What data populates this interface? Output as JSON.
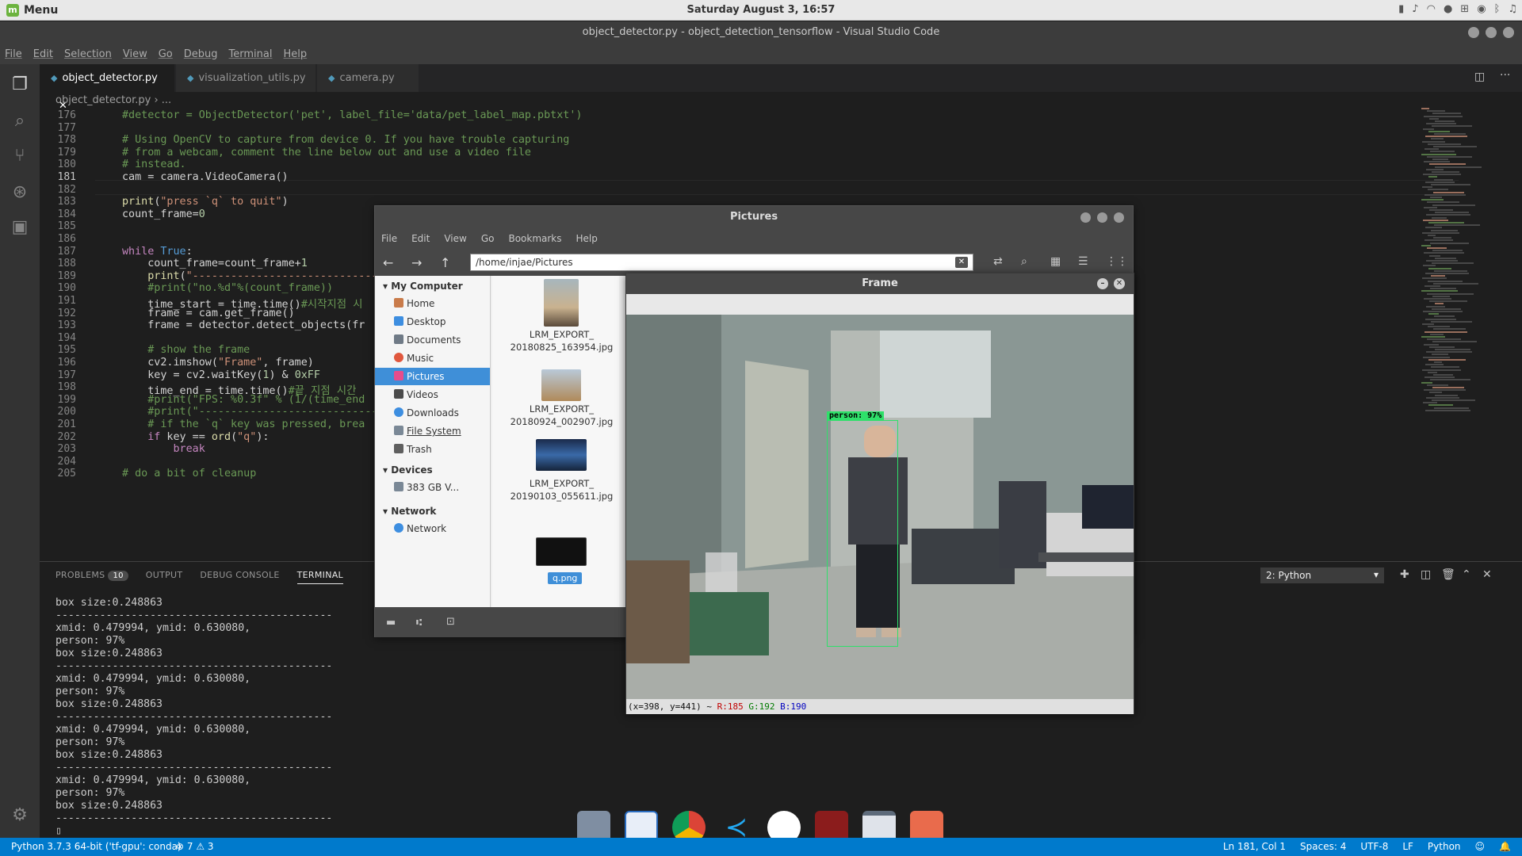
{
  "top_panel": {
    "menu_label": "Menu",
    "clock": "Saturday August  3, 16:57"
  },
  "window_title": "object_detector.py - object_detection_tensorflow - Visual Studio Code",
  "menubar": [
    "File",
    "Edit",
    "Selection",
    "View",
    "Go",
    "Debug",
    "Terminal",
    "Help"
  ],
  "tabs": [
    {
      "label": "object_detector.py",
      "active": true
    },
    {
      "label": "visualization_utils.py",
      "active": false
    },
    {
      "label": "camera.py",
      "active": false
    }
  ],
  "breadcrumb": "object_detector.py › ...",
  "editor": {
    "current_line": 181,
    "lines": [
      {
        "n": 176,
        "html": "<span class='c-com'>#detector = ObjectDetector('pet', label_file='data/pet_label_map.pbtxt')</span>"
      },
      {
        "n": 177,
        "html": ""
      },
      {
        "n": 178,
        "html": "<span class='c-com'># Using OpenCV to capture from device 0. If you have trouble capturing</span>"
      },
      {
        "n": 179,
        "html": "<span class='c-com'># from a webcam, comment the line below out and use a video file</span>"
      },
      {
        "n": 180,
        "html": "<span class='c-com'># instead.</span>"
      },
      {
        "n": 181,
        "html": "cam = camera.VideoCamera()"
      },
      {
        "n": 182,
        "html": ""
      },
      {
        "n": 183,
        "html": "<span class='c-fn'>print</span>(<span class='c-str'>\"press `q` to quit\"</span>)"
      },
      {
        "n": 184,
        "html": "count_frame=<span class='c-num'>0</span>"
      },
      {
        "n": 185,
        "html": ""
      },
      {
        "n": 186,
        "html": ""
      },
      {
        "n": 187,
        "html": "<span class='c-kw'>while</span> <span style='color:#569cd6'>True</span>:"
      },
      {
        "n": 188,
        "html": "    count_frame=count_frame+<span class='c-num'>1</span>"
      },
      {
        "n": 189,
        "html": "    <span class='c-fn'>print</span>(<span class='c-str'>\"------------------------------</span>"
      },
      {
        "n": 190,
        "html": "    <span class='c-com'>#print(\"no.%d\"%(count_frame))</span>"
      },
      {
        "n": 191,
        "html": "    time_start = time.time()<span class='c-com'>#시작지점 시</span>"
      },
      {
        "n": 192,
        "html": "    frame = cam.get_frame()"
      },
      {
        "n": 193,
        "html": "    frame = detector.detect_objects(fr"
      },
      {
        "n": 194,
        "html": ""
      },
      {
        "n": 195,
        "html": "    <span class='c-com'># show the frame</span>"
      },
      {
        "n": 196,
        "html": "    cv2.imshow(<span class='c-str'>\"Frame\"</span>, frame)"
      },
      {
        "n": 197,
        "html": "    key = cv2.waitKey(<span class='c-num'>1</span>) &amp; <span class='c-num'>0xFF</span>"
      },
      {
        "n": 198,
        "html": "    time_end = time.time()<span class='c-com'>#끝 지점 시간</span>"
      },
      {
        "n": 199,
        "html": "    <span class='c-com'>#print(\"FPS: %0.3f\" % (1/(time_end</span>"
      },
      {
        "n": 200,
        "html": "    <span class='c-com'>#print(\"------------------------------</span>"
      },
      {
        "n": 201,
        "html": "    <span class='c-com'># if the `q` key was pressed, brea</span>"
      },
      {
        "n": 202,
        "html": "    <span class='c-kw'>if</span> key == <span class='c-fn'>ord</span>(<span class='c-str'>\"q\"</span>):"
      },
      {
        "n": 203,
        "html": "        <span class='c-kw'>break</span>"
      },
      {
        "n": 204,
        "html": ""
      },
      {
        "n": 205,
        "html": "<span class='c-com'># do a bit of cleanup</span>"
      }
    ]
  },
  "panel": {
    "tabs": [
      "PROBLEMS",
      "OUTPUT",
      "DEBUG CONSOLE",
      "TERMINAL"
    ],
    "problems_count": "10",
    "terminal_select": "2: Python",
    "terminal_text": "box size:0.248863\n--------------------------------------------\nxmid: 0.479994, ymid: 0.630080,\nperson: 97%\nbox size:0.248863\n--------------------------------------------\nxmid: 0.479994, ymid: 0.630080,\nperson: 97%\nbox size:0.248863\n--------------------------------------------\nxmid: 0.479994, ymid: 0.630080,\nperson: 97%\nbox size:0.248863\n--------------------------------------------\nxmid: 0.479994, ymid: 0.630080,\nperson: 97%\nbox size:0.248863\n--------------------------------------------\n▯"
  },
  "statusbar": {
    "interpreter": "Python 3.7.3 64-bit ('tf-gpu': conda)",
    "errors": "⊗ 7",
    "warnings": "⚠ 3",
    "position": "Ln 181, Col 1",
    "spaces": "Spaces: 4",
    "encoding": "UTF-8",
    "eol": "LF",
    "language": "Python"
  },
  "file_manager": {
    "title": "Pictures",
    "menu": [
      "File",
      "Edit",
      "View",
      "Go",
      "Bookmarks",
      "Help"
    ],
    "path": "/home/injae/Pictures",
    "sections": {
      "my_computer": "My Computer",
      "devices": "Devices",
      "network": "Network"
    },
    "places": [
      "Home",
      "Desktop",
      "Documents",
      "Music",
      "Pictures",
      "Videos",
      "Downloads",
      "File System",
      "Trash"
    ],
    "device_items": [
      "383 GB V..."
    ],
    "network_items": [
      "Network"
    ],
    "files": [
      {
        "line1": "LRM_EXPORT_",
        "line2": "20180825_163954.jpg"
      },
      {
        "line1": "LRM_EXPORT_",
        "line2": "20180924_002907.jpg"
      },
      {
        "line1": "LRM_EXPORT_",
        "line2": "20190103_055611.jpg"
      },
      {
        "line1": "q.png",
        "line2": ""
      }
    ]
  },
  "frame_window": {
    "title": "Frame",
    "detection_label": "person: 97%",
    "status_coords": "(x=398, y=441) ~",
    "status_r": "R:185",
    "status_g": "G:192",
    "status_b": "B:190"
  },
  "colors": {
    "accent": "#007acc",
    "detection": "#2fe06a",
    "selection": "#3f8fd8"
  }
}
